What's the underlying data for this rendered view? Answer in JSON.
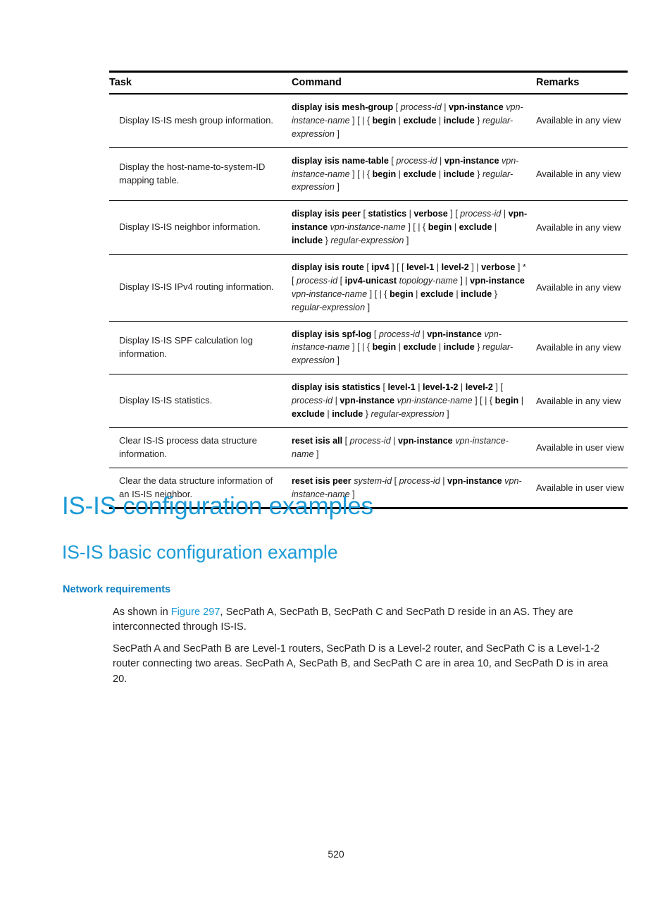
{
  "table": {
    "headers": [
      "Task",
      "Command",
      "Remarks"
    ],
    "rows": [
      {
        "task": "Display IS-IS mesh group information.",
        "command_html": "<b>display isis mesh-group</b> [ <i>process-id</i> | <b>vpn-instance</b> <i>vpn-instance-name</i> ] [ | { <b>begin</b> | <b>exclude</b> | <b>include</b> } <i>regular-expression</i> ]",
        "remark": "Available in any view"
      },
      {
        "task": "Display the host-name-to-system-ID mapping table.",
        "command_html": "<b>display isis name-table</b> [ <i>process-id</i> | <b>vpn-instance</b> <i>vpn-instance-name</i> ] [ | { <b>begin</b> | <b>exclude</b> | <b>include</b> } <i>regular-expression</i> ]",
        "remark": "Available in any view"
      },
      {
        "task": "Display IS-IS neighbor information.",
        "command_html": "<b>display isis peer</b> [ <b>statistics</b> | <b>verbose</b> ] [ <i>process-id</i> | <b>vpn-instance</b> <i>vpn-instance-name</i> ] [ | { <b>begin</b> | <b>exclude</b> | <b>include</b> } <i>regular-expression</i> ]",
        "remark": "Available in any view"
      },
      {
        "task": "Display IS-IS IPv4 routing information.",
        "command_html": "<b>display isis route</b> [ <b>ipv4</b> ] [ [ <b>level-1</b> | <b>level-2</b> ] | <b>verbose</b> ] * [ <i>process-id</i> [ <b>ipv4-unicast</b> <i>topology-name</i> ] | <b>vpn-instance</b> <i>vpn-instance-name</i> ] [ | { <b>begin</b> | <b>exclude</b> | <b>include</b> } <i>regular-expression</i> ]",
        "remark": "Available in any view"
      },
      {
        "task": "Display IS-IS SPF  calculation log information.",
        "command_html": "<b>display isis spf-log</b> [ <i>process-id</i> | <b>vpn-instance</b> <i>vpn-instance-name</i> ] [ | { <b>begin</b> | <b>exclude</b> | <b>include</b> } <i>regular-expression</i> ]",
        "remark": "Available in any view"
      },
      {
        "task": "Display IS-IS statistics.",
        "command_html": "<b>display isis statistics</b> [ <b>level-1</b> | <b>level-1-2</b> | <b>level-2</b> ] [ <i>process-id</i> | <b>vpn-instance</b> <i>vpn-instance-name</i> ] [ | { <b>begin</b> | <b>exclude</b> | <b>include</b> } <i>regular-expression</i> ]",
        "remark": "Available in any view"
      },
      {
        "task": "Clear IS-IS process data structure information.",
        "command_html": "<b>reset isis all</b> [ <i>process-id</i> | <b>vpn-instance</b> <i>vpn-instance-name</i> ]",
        "remark": "Available in user view"
      },
      {
        "task": "Clear the data structure information of an IS-IS neighbor.",
        "command_html": "<b>reset isis peer</b> <i>system-id</i> [ <i>process-id</i> | <b>vpn-instance</b> <i>vpn-instance-name</i> ]",
        "remark": "Available in user view"
      }
    ]
  },
  "headings": {
    "h1": "IS-IS configuration examples",
    "h2": "IS-IS basic configuration example",
    "h3": "Network requirements"
  },
  "paragraphs": {
    "p1_before_link": "As shown in ",
    "p1_link": "Figure 297",
    "p1_after_link": ", SecPath A, SecPath B, SecPath C and SecPath D reside in an AS. They are interconnected through IS-IS.",
    "p2": "SecPath A and SecPath B are Level-1 routers, SecPath D is a Level-2 router, and SecPath C is a Level-1-2 router connecting two areas. SecPath A, SecPath B, and SecPath C are in area 10, and SecPath D is in area 20."
  },
  "footer": {
    "page_number": "520"
  },
  "colors": {
    "heading_accent": "#1b9ad6",
    "subheading_accent": "#0b7fc4",
    "body_text": "#231f20",
    "rule": "#000000"
  }
}
